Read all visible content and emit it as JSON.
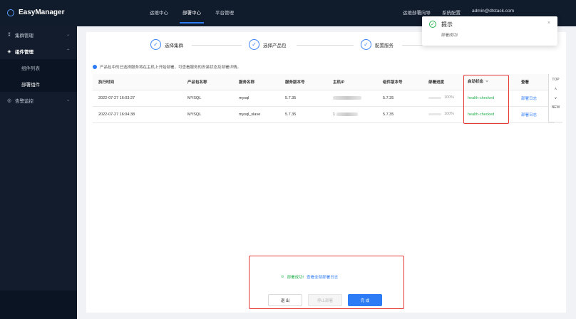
{
  "app": {
    "title": "EasyManager"
  },
  "topnav": [
    "运维中心",
    "部署中心",
    "平台管理"
  ],
  "topright": {
    "text1": "运维部署向导",
    "text2": "系统配置",
    "user": "admin@dtstack.com"
  },
  "sidebar": {
    "cluster": "集群管理",
    "components": "组件管理",
    "component_list": "组件列表",
    "deploy_component": "部署组件",
    "alert": "告警监控"
  },
  "steps": [
    "选择集群",
    "选择产品包",
    "配置服务"
  ],
  "info_text": "产品包中的已选择服务将在主机上开始部署，可查看服务的安装状态及部署详情。",
  "table": {
    "headers": [
      "执行时间",
      "产品包名称",
      "服务名称",
      "服务版本号",
      "主机IP",
      "组件版本号",
      "部署进度",
      "启动状态",
      "查看"
    ],
    "rows": [
      {
        "time": "2022-07-27 16:03:27",
        "product": "MYSQL",
        "service": "mysql",
        "version": "5.7.35",
        "ip_prefix": "",
        "component_version": "5.7.35",
        "progress_pct": 100,
        "progress_label": "100%",
        "status": "health-checked",
        "view": "部署日志"
      },
      {
        "time": "2022-07-27 16:04:38",
        "product": "MYSQL",
        "service": "mysql_slave",
        "version": "5.7.35",
        "ip_prefix": "1",
        "component_version": "5.7.35",
        "progress_pct": 100,
        "progress_label": "100%",
        "status": "health-checked",
        "view": "部署日志"
      }
    ]
  },
  "fixed_col": {
    "top": "TOP",
    "new": "NEW"
  },
  "footer": {
    "success": "部署成功!",
    "view_all_logs": "查看全部部署日志",
    "exit": "退 出",
    "stop": "停止部署",
    "finish": "完 成"
  },
  "toast": {
    "title": "提示",
    "message": "部署成功!"
  },
  "colors": {
    "accent": "#2d7bf5",
    "success": "#23b04b",
    "highlight": "#e53935"
  }
}
